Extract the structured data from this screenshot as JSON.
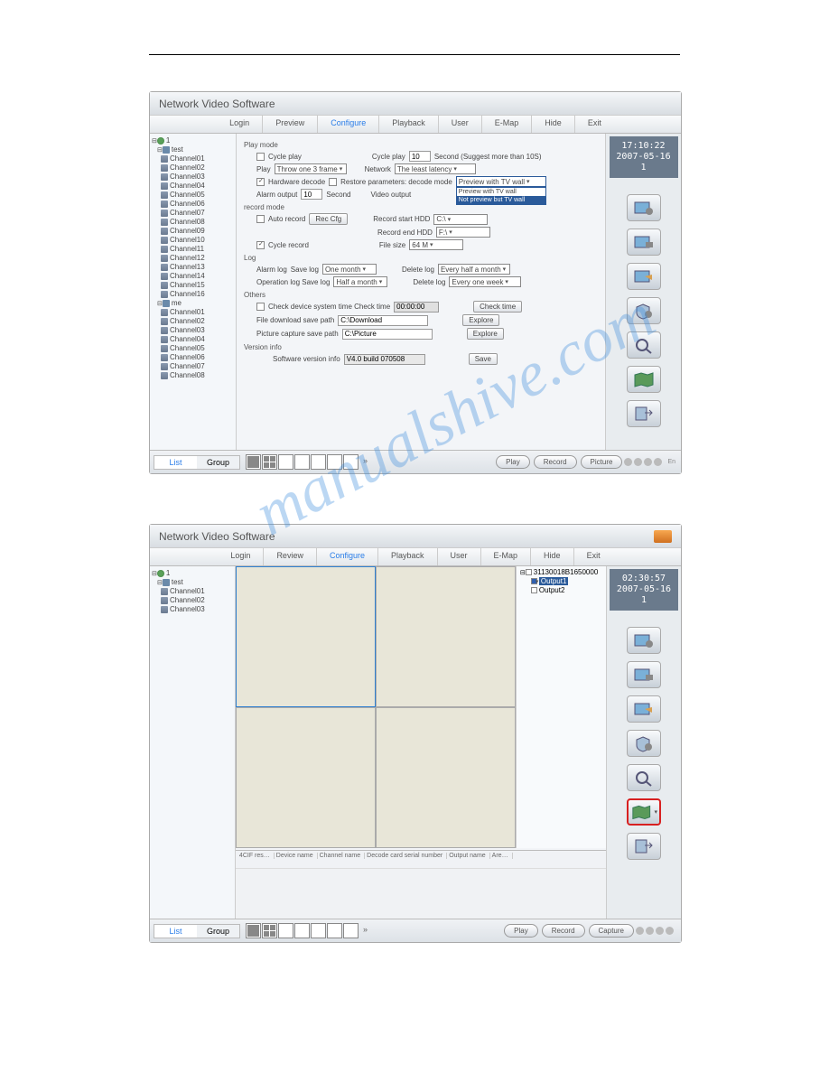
{
  "watermark": "manualshive.com",
  "window1": {
    "title": "Network Video Software",
    "menu": [
      "Login",
      "Preview",
      "Configure",
      "Playback",
      "User",
      "E-Map",
      "Hide",
      "Exit"
    ],
    "active_menu_idx": 2,
    "clock": {
      "time": "17:10:22",
      "date": "2007-05-16",
      "line3": "1"
    },
    "tree": {
      "root": "1",
      "groups": [
        {
          "name": "test",
          "channels": [
            "Channel01",
            "Channel02",
            "Channel03",
            "Channel04",
            "Channel05",
            "Channel06",
            "Channel07",
            "Channel08",
            "Channel09",
            "Channel10",
            "Channel11",
            "Channel12",
            "Channel13",
            "Channel14",
            "Channel15",
            "Channel16"
          ]
        },
        {
          "name": "me",
          "channels": [
            "Channel01",
            "Channel02",
            "Channel03",
            "Channel04",
            "Channel05",
            "Channel06",
            "Channel07",
            "Channel08"
          ]
        }
      ]
    },
    "side_tabs": [
      "List",
      "Group"
    ],
    "active_side_tab": 0,
    "bottom_buttons": [
      "Play",
      "Record",
      "Picture"
    ],
    "En": "En",
    "sections": {
      "play_mode": {
        "title": "Play mode",
        "cycle_play_chk": false,
        "cycle_play_label": "Cycle play",
        "cycle_play_label2": "Cycle play",
        "cycle_play_value": "10",
        "cycle_play_hint": "Second (Suggest more than 10S)",
        "play_label": "Play",
        "play_value": "Throw one 3 frame",
        "network_label": "Network",
        "network_value": "The least latency",
        "hw_decode_chk": true,
        "hw_decode_label": "Hardware decode",
        "restore_chk": false,
        "restore_label": "Restore parameters: decode mode",
        "preview_value": "Preview with TV wall",
        "preview_options": [
          "Preview with TV wall",
          "Not preview but TV wall"
        ],
        "alarm_output_label": "Alarm output",
        "alarm_output_value": "10",
        "seconds": "Second",
        "video_output_label": "Video output"
      },
      "record_mode": {
        "title": "record mode",
        "auto_rec_chk": false,
        "auto_rec_label": "Auto record",
        "rec_cfg_btn": "Rec Cfg",
        "start_hdd_label": "Record start HDD",
        "start_hdd_value": "C:\\",
        "end_hdd_label": "Record end HDD",
        "end_hdd_value": "F:\\",
        "cycle_rec_chk": true,
        "cycle_rec_label": "Cycle record",
        "file_size_label": "File size",
        "file_size_value": "64 M"
      },
      "log": {
        "title": "Log",
        "alarm_log_label": "Alarm log",
        "save_log_label": "Save log",
        "alarm_save_value": "One month",
        "delete_log_label": "Delete log",
        "alarm_delete_value": "Every half a month",
        "op_log_label": "Operation log Save log",
        "op_save_value": "Half a month",
        "op_delete_value": "Every one week"
      },
      "others": {
        "title": "Others",
        "check_time_chk": false,
        "check_time_label": "Check device system time Check time",
        "check_time_value": "00:00:00",
        "check_time_btn": "Check time",
        "file_dl_label": "File download save path",
        "file_dl_value": "C:\\Download",
        "pic_cap_label": "Picture capture save path",
        "pic_cap_value": "C:\\Picture",
        "explore_btn": "Explore"
      },
      "version": {
        "title": "Version info",
        "label": "Software version info",
        "value": "V4.0 build 070508",
        "save_btn": "Save"
      }
    }
  },
  "window2": {
    "title": "Network Video Software",
    "menu": [
      "Login",
      "Review",
      "Configure",
      "Playback",
      "User",
      "E-Map",
      "Hide",
      "Exit"
    ],
    "active_menu_idx": 2,
    "clock": {
      "time": "02:30:57",
      "date": "2007-05-16",
      "line3": "1"
    },
    "tree": {
      "root": "1",
      "groups": [
        {
          "name": "test",
          "channels": [
            "Channel01",
            "Channel02",
            "Channel03"
          ]
        }
      ]
    },
    "side_tabs": [
      "List",
      "Group"
    ],
    "active_side_tab": 0,
    "bottom_buttons": [
      "Play",
      "Record",
      "Capture"
    ],
    "output_tree": {
      "device": "31130018B1650000",
      "outputs": [
        "Output1",
        "Output2"
      ],
      "selected": 0
    },
    "table_cols": [
      "4CIF res…",
      "Device name",
      "Channel name",
      "Decode card serial number",
      "Output name",
      "Are…"
    ],
    "selected_right_button": 5
  }
}
